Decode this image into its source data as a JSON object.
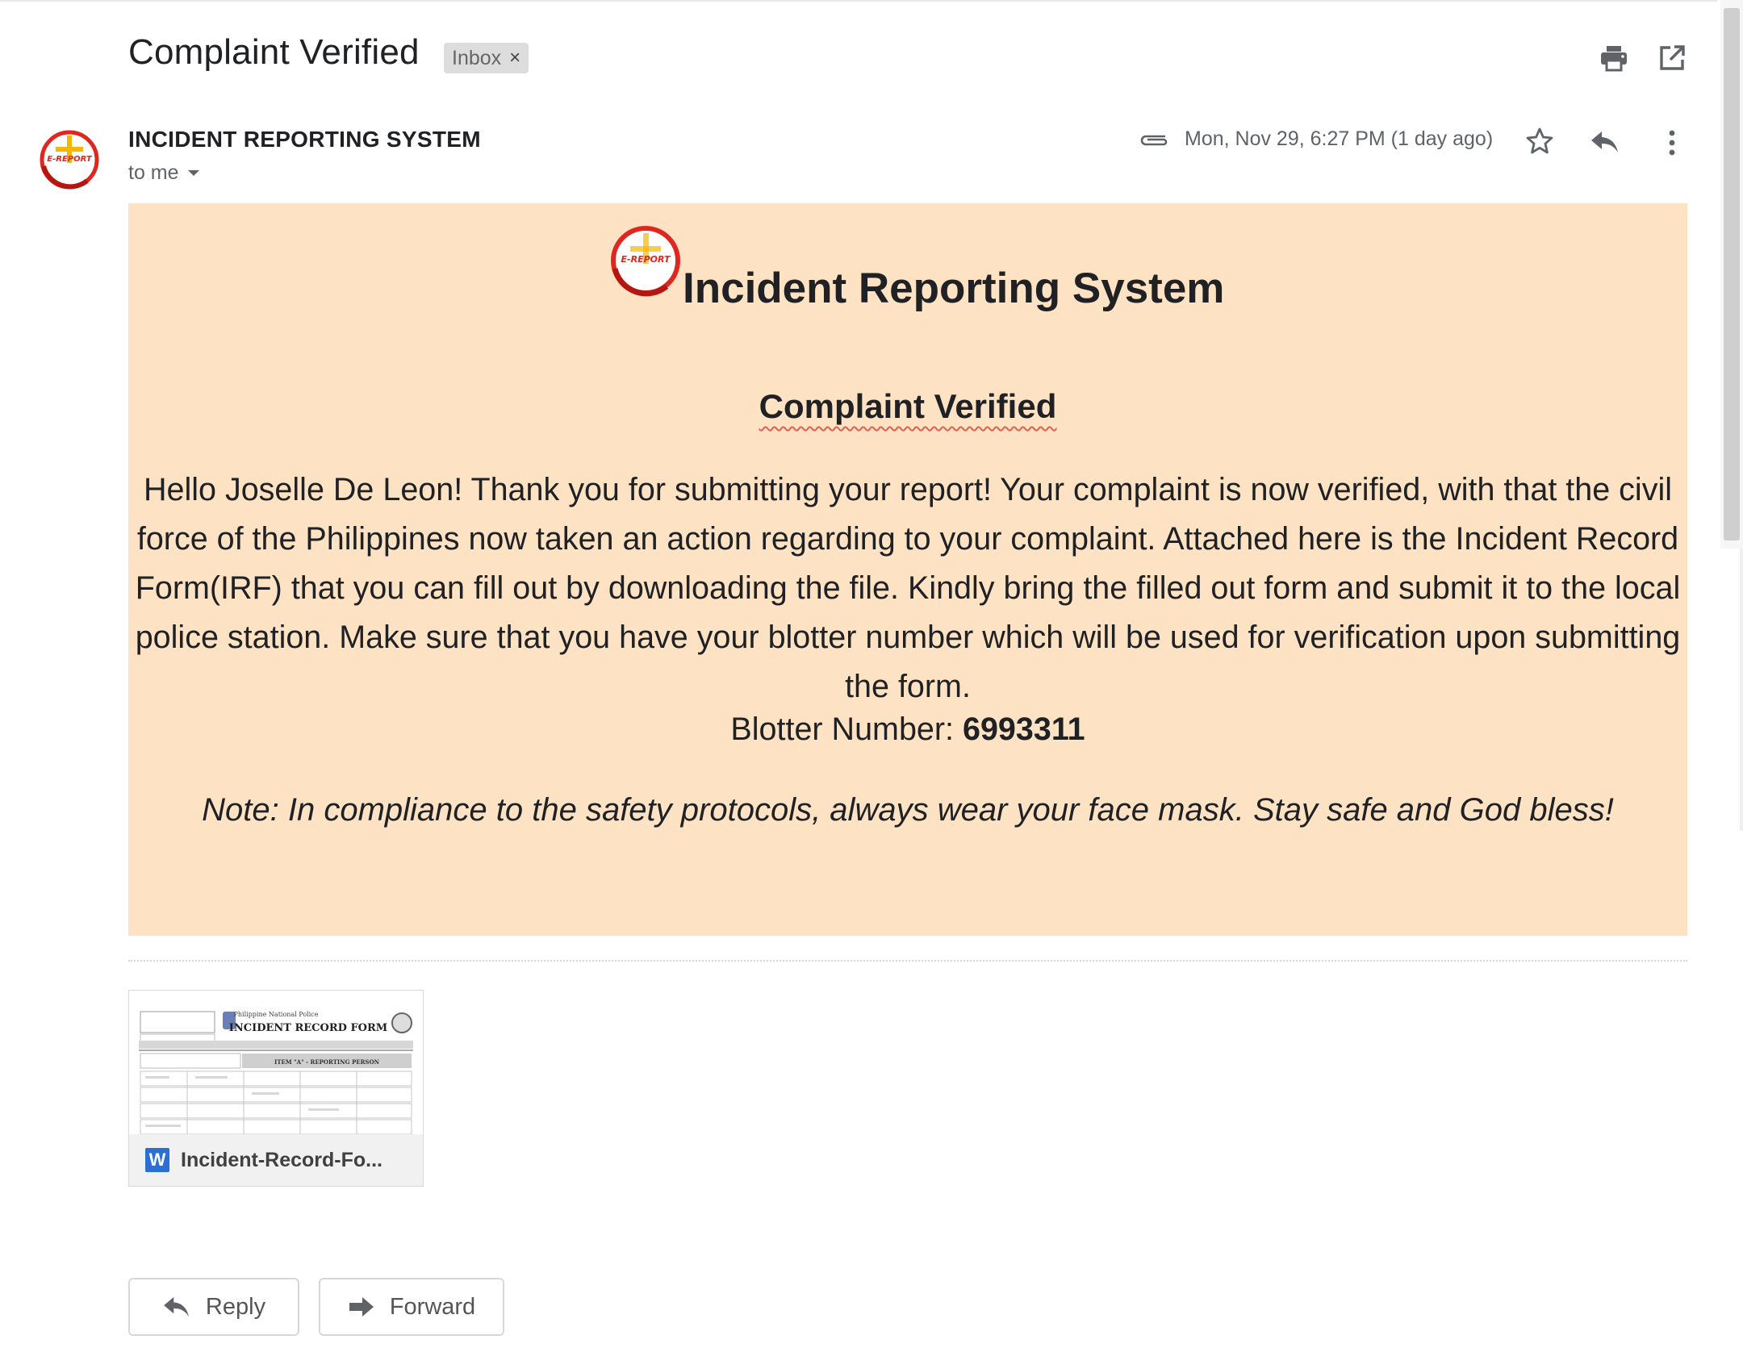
{
  "subject": "Complaint Verified",
  "label_chip": {
    "text": "Inbox",
    "close": "×"
  },
  "toolbar_icons": [
    "printer-icon",
    "open-in-new-window-icon"
  ],
  "sender": {
    "name": "INCIDENT REPORTING SYSTEM",
    "recipient": "to me",
    "date": "Mon, Nov 29, 6:27 PM (1 day ago)"
  },
  "message_icons": [
    "paperclip-icon",
    "star-icon",
    "reply-icon",
    "more-vert-icon"
  ],
  "logo_text": "E-REPORT",
  "body": {
    "brand_title": "Incident Reporting System",
    "heading": "Complaint Verified",
    "paragraph": "Hello Joselle De Leon! Thank you for submitting your report! Your complaint is now verified, with that the civil force of the Philippines now taken an action regarding to your complaint. Attached here is the Incident Record Form(IRF) that you can fill out by downloading the file. Kindly bring the filled out form and submit it to the local police station. Make sure that you have your blotter number which will be used for verification upon submitting the form.",
    "blotter_label": "Blotter Number: ",
    "blotter_number": "6993311",
    "note": "Note: In compliance to the safety protocols, always wear your face mask. Stay safe and God bless!"
  },
  "attachment": {
    "file_type": "W",
    "name": "Incident-Record-Fo...",
    "preview_agency": "Philippine National Police",
    "preview_title": "INCIDENT RECORD FORM",
    "preview_section": "ITEM \"A\" - REPORTING PERSON"
  },
  "actions": {
    "reply": "Reply",
    "forward": "Forward"
  },
  "colors": {
    "body_background": "#fde2c3",
    "accent_red": "#e0261f",
    "logo_yellow": "#f5b800",
    "word_blue": "#2a6fd6"
  }
}
